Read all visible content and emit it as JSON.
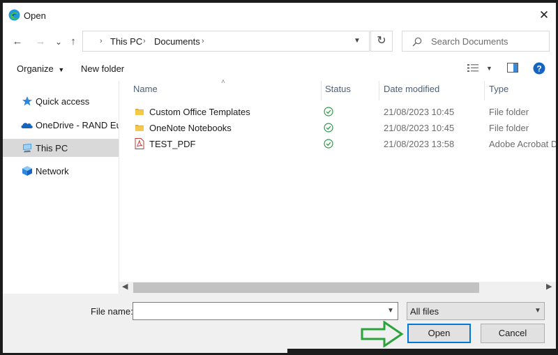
{
  "window": {
    "title": "Open",
    "app_icon": "edge-icon"
  },
  "nav": {
    "back": "←",
    "forward": "→",
    "recent": "⌄",
    "up": "↑",
    "breadcrumb": [
      "This PC",
      "Documents"
    ],
    "refresh": "↻",
    "search_placeholder": "Search Documents"
  },
  "toolbar": {
    "organize_label": "Organize",
    "new_folder_label": "New folder"
  },
  "sidebar": {
    "items": [
      {
        "label": "Quick access",
        "icon": "star-icon"
      },
      {
        "label": "OneDrive - RAND Europe",
        "icon": "cloud-icon"
      },
      {
        "label": "This PC",
        "icon": "computer-icon",
        "selected": true
      },
      {
        "label": "Network",
        "icon": "network-icon"
      }
    ]
  },
  "files": {
    "columns": [
      "Name",
      "Status",
      "Date modified",
      "Type"
    ],
    "rows": [
      {
        "name": "Custom Office Templates",
        "icon": "folder-icon",
        "status": "synced",
        "date": "21/08/2023 10:45",
        "type": "File folder"
      },
      {
        "name": "OneNote Notebooks",
        "icon": "folder-icon",
        "status": "synced",
        "date": "21/08/2023 10:45",
        "type": "File folder"
      },
      {
        "name": "TEST_PDF",
        "icon": "pdf-icon",
        "status": "synced",
        "date": "21/08/2023 13:58",
        "type": "Adobe Acrobat D"
      }
    ]
  },
  "footer": {
    "file_name_label": "File name:",
    "file_name_value": "",
    "file_type": "All files",
    "open_label": "Open",
    "cancel_label": "Cancel"
  },
  "colors": {
    "accent": "#0078d7",
    "arrow_annotation": "#2aa33a"
  }
}
